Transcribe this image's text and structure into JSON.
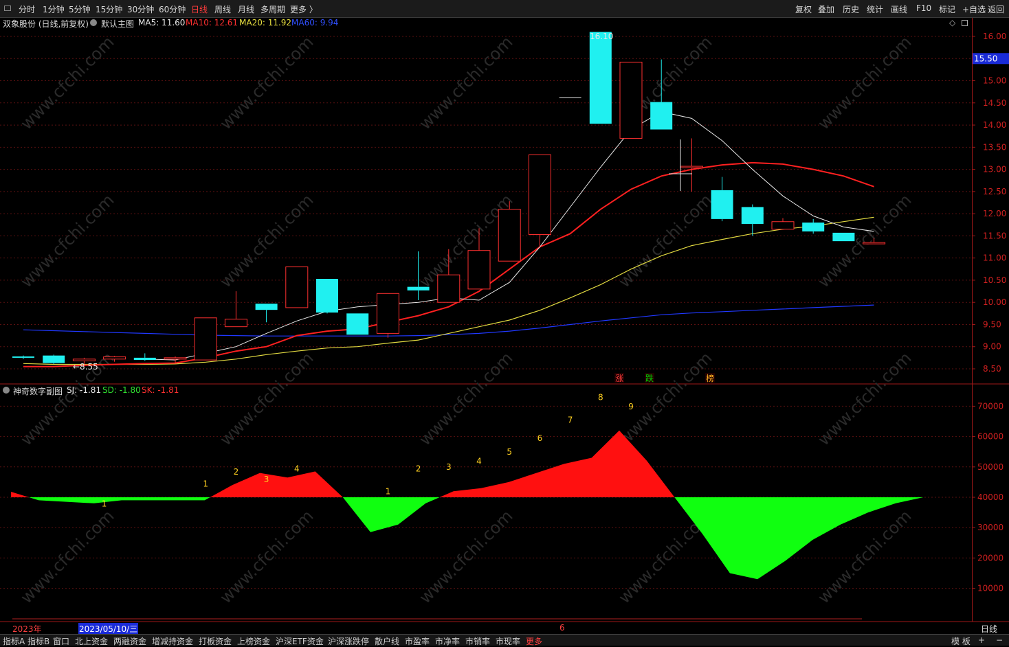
{
  "toolbar": {
    "left": [
      "分时",
      "1分钟",
      "5分钟",
      "15分钟",
      "30分钟",
      "60分钟",
      "日线",
      "周线",
      "月线",
      "多周期",
      "更多 〉"
    ],
    "active_label": "日线",
    "right": [
      "复权",
      "叠加",
      "历史",
      "统计",
      "画线",
      "F10",
      "标记",
      "+自选",
      "返回"
    ]
  },
  "main_legend": {
    "stock": "双象股份 (日线,前复权)",
    "chart_name": "默认主图",
    "ma5": "MA5: 11.60",
    "ma10": "MA10: 12.61",
    "ma20": "MA20: 11.92",
    "ma60": "MA60: 9.94"
  },
  "sub_legend": {
    "name": "神奇数字副图",
    "sj": "SJ: -1.81",
    "sd": "SD: -1.80",
    "sk": "SK: -1.81"
  },
  "price_axis": {
    "ticks": [
      "16.00",
      "15.50",
      "15.00",
      "14.50",
      "14.00",
      "13.50",
      "13.00",
      "12.50",
      "12.00",
      "11.50",
      "11.00",
      "10.50",
      "10.00",
      "9.50",
      "9.00",
      "8.50"
    ],
    "current_price": "15.50"
  },
  "sub_axis": {
    "ticks": [
      "70000",
      "60000",
      "50000",
      "40000",
      "30000",
      "20000",
      "10000"
    ]
  },
  "annotations": {
    "high": "16.10",
    "low": "←8.55",
    "markers": [
      {
        "text": "涨",
        "color": "#ff3c3c"
      },
      {
        "text": "跌",
        "color": "#00d000"
      },
      {
        "text": "榜",
        "color": "#ffb020"
      }
    ]
  },
  "chart_data": {
    "type": "candlestick",
    "price_ylim": [
      8.3,
      16.2
    ],
    "candles": [
      {
        "o": 8.78,
        "h": 8.8,
        "l": 8.72,
        "c": 8.75
      },
      {
        "o": 8.8,
        "h": 8.82,
        "l": 8.61,
        "c": 8.63
      },
      {
        "o": 8.68,
        "h": 8.75,
        "l": 8.55,
        "c": 8.72
      },
      {
        "o": 8.72,
        "h": 8.79,
        "l": 8.66,
        "c": 8.77
      },
      {
        "o": 8.75,
        "h": 8.85,
        "l": 8.68,
        "c": 8.7
      },
      {
        "o": 8.72,
        "h": 8.78,
        "l": 8.62,
        "c": 8.75
      },
      {
        "o": 8.7,
        "h": 9.65,
        "l": 8.7,
        "c": 9.65
      },
      {
        "o": 9.45,
        "h": 10.25,
        "l": 9.45,
        "c": 9.62
      },
      {
        "o": 9.97,
        "h": 9.97,
        "l": 9.55,
        "c": 9.83
      },
      {
        "o": 9.88,
        "h": 10.8,
        "l": 9.88,
        "c": 10.8
      },
      {
        "o": 10.53,
        "h": 10.53,
        "l": 9.75,
        "c": 9.77
      },
      {
        "o": 9.75,
        "h": 9.75,
        "l": 9.27,
        "c": 9.27
      },
      {
        "o": 9.3,
        "h": 10.2,
        "l": 9.2,
        "c": 10.2
      },
      {
        "o": 10.35,
        "h": 11.15,
        "l": 10.05,
        "c": 10.27
      },
      {
        "o": 10.0,
        "h": 11.2,
        "l": 10.0,
        "c": 10.62
      },
      {
        "o": 10.3,
        "h": 11.67,
        "l": 10.3,
        "c": 11.17
      },
      {
        "o": 10.93,
        "h": 12.28,
        "l": 10.93,
        "c": 12.1
      },
      {
        "o": 11.53,
        "h": 13.33,
        "l": 11.25,
        "c": 13.33
      },
      {
        "o": 14.62,
        "h": 14.62,
        "l": 14.62,
        "c": 14.62
      },
      {
        "o": 16.1,
        "h": 16.1,
        "l": 14.03,
        "c": 14.03
      },
      {
        "o": 13.7,
        "h": 15.42,
        "l": 13.7,
        "c": 15.42
      },
      {
        "o": 14.52,
        "h": 15.48,
        "l": 13.9,
        "c": 13.9
      },
      {
        "o": 13.07,
        "h": 13.7,
        "l": 12.5,
        "c": 13.07
      },
      {
        "o": 12.53,
        "h": 12.83,
        "l": 11.83,
        "c": 11.88
      },
      {
        "o": 12.15,
        "h": 12.21,
        "l": 11.5,
        "c": 11.77
      },
      {
        "o": 11.65,
        "h": 11.9,
        "l": 11.65,
        "c": 11.82
      },
      {
        "o": 11.8,
        "h": 11.88,
        "l": 11.55,
        "c": 11.6
      },
      {
        "o": 11.57,
        "h": 11.57,
        "l": 11.38,
        "c": 11.38
      },
      {
        "o": 11.32,
        "h": 11.45,
        "l": 11.32,
        "c": 11.35
      }
    ],
    "ma5": [
      null,
      null,
      null,
      null,
      8.72,
      8.7,
      8.85,
      9.0,
      9.3,
      9.58,
      9.8,
      9.9,
      9.95,
      10.0,
      10.1,
      10.05,
      10.45,
      11.25,
      12.15,
      13.05,
      13.9,
      14.3,
      14.15,
      13.65,
      13.0,
      12.4,
      11.95,
      11.7,
      11.6
    ],
    "ma10": [
      8.55,
      8.55,
      8.58,
      8.6,
      8.62,
      8.63,
      8.75,
      8.9,
      9.0,
      9.25,
      9.35,
      9.4,
      9.55,
      9.7,
      9.9,
      10.25,
      10.75,
      11.25,
      11.55,
      12.1,
      12.55,
      12.85,
      13.0,
      13.1,
      13.15,
      13.12,
      13.0,
      12.85,
      12.61
    ],
    "ma20": [
      8.62,
      8.6,
      8.6,
      8.6,
      8.6,
      8.61,
      8.65,
      8.72,
      8.82,
      8.9,
      8.97,
      9.0,
      9.08,
      9.15,
      9.3,
      9.45,
      9.6,
      9.82,
      10.1,
      10.4,
      10.75,
      11.05,
      11.28,
      11.42,
      11.55,
      11.65,
      11.72,
      11.82,
      11.92
    ],
    "ma60": [
      9.38,
      9.36,
      9.34,
      9.32,
      9.3,
      9.28,
      9.26,
      9.25,
      9.24,
      9.24,
      9.24,
      9.24,
      9.24,
      9.25,
      9.27,
      9.3,
      9.35,
      9.42,
      9.5,
      9.58,
      9.65,
      9.72,
      9.76,
      9.79,
      9.82,
      9.85,
      9.88,
      9.91,
      9.94
    ],
    "sub_ylim": [
      0,
      75000
    ],
    "sub_baseline": 40000,
    "sub_values": [
      41800,
      39000,
      38500,
      38000,
      39000,
      39000,
      39000,
      39000,
      44000,
      48000,
      46500,
      48500,
      40000,
      28500,
      31000,
      38000,
      42000,
      43000,
      45000,
      48000,
      51000,
      53000,
      62000,
      52000,
      40000,
      28000,
      15000,
      13000,
      19000,
      26000,
      31000,
      35000,
      38000,
      40000
    ],
    "sub_x_offset": -0.5,
    "count_labels": [
      {
        "i": 3,
        "text": "1",
        "v": 37000
      },
      {
        "i": 6,
        "text": "1",
        "v": 43500
      },
      {
        "i": 7,
        "text": "2",
        "v": 47500
      },
      {
        "i": 8,
        "text": "3",
        "v": 45000
      },
      {
        "i": 9,
        "text": "4",
        "v": 48500
      },
      {
        "i": 12,
        "text": "1",
        "v": 41000
      },
      {
        "i": 13,
        "text": "2",
        "v": 48500
      },
      {
        "i": 14,
        "text": "3",
        "v": 49000
      },
      {
        "i": 15,
        "text": "4",
        "v": 51000
      },
      {
        "i": 16,
        "text": "5",
        "v": 54000
      },
      {
        "i": 17,
        "text": "6",
        "v": 58500
      },
      {
        "i": 18,
        "text": "7",
        "v": 64500
      },
      {
        "i": 19,
        "text": "8",
        "v": 72000
      },
      {
        "i": 20,
        "text": "9",
        "v": 69000
      }
    ]
  },
  "date_bar": {
    "year": "2023年",
    "date": "2023/05/10/三",
    "month": "6",
    "period": "日线"
  },
  "bottom_tabs": [
    "指标A",
    "指标B",
    "窗口",
    "北上资金",
    "两融资金",
    "增减持资金",
    "打板资金",
    "上榜资金",
    "沪深ETF资金",
    "沪深涨跌停",
    "散户线",
    "市盈率",
    "市净率",
    "市销率",
    "市现率",
    "更多"
  ],
  "bottom_right": [
    "模 板",
    "+",
    "−"
  ]
}
